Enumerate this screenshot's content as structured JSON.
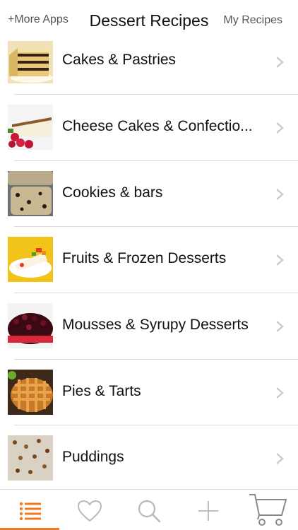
{
  "header": {
    "more_apps": "+More Apps",
    "title": "Dessert Recipes",
    "my_recipes": "My Recipes"
  },
  "categories": [
    {
      "label": "Cakes & Pastries"
    },
    {
      "label": "Cheese Cakes & Confectio..."
    },
    {
      "label": "Cookies & bars"
    },
    {
      "label": "Fruits & Frozen Desserts"
    },
    {
      "label": "Mousses & Syrupy Desserts"
    },
    {
      "label": "Pies & Tarts"
    },
    {
      "label": "Puddings"
    }
  ],
  "tabs": [
    {
      "icon": "list-icon",
      "active": true
    },
    {
      "icon": "heart-icon",
      "active": false
    },
    {
      "icon": "search-icon",
      "active": false
    },
    {
      "icon": "plus-icon",
      "active": false
    },
    {
      "icon": "cart-icon",
      "active": false
    }
  ],
  "colors": {
    "accent": "#f07a22",
    "icon_inactive": "#b8b8b8",
    "separator": "#d9d9d9",
    "chevron": "#c7c7cc"
  }
}
